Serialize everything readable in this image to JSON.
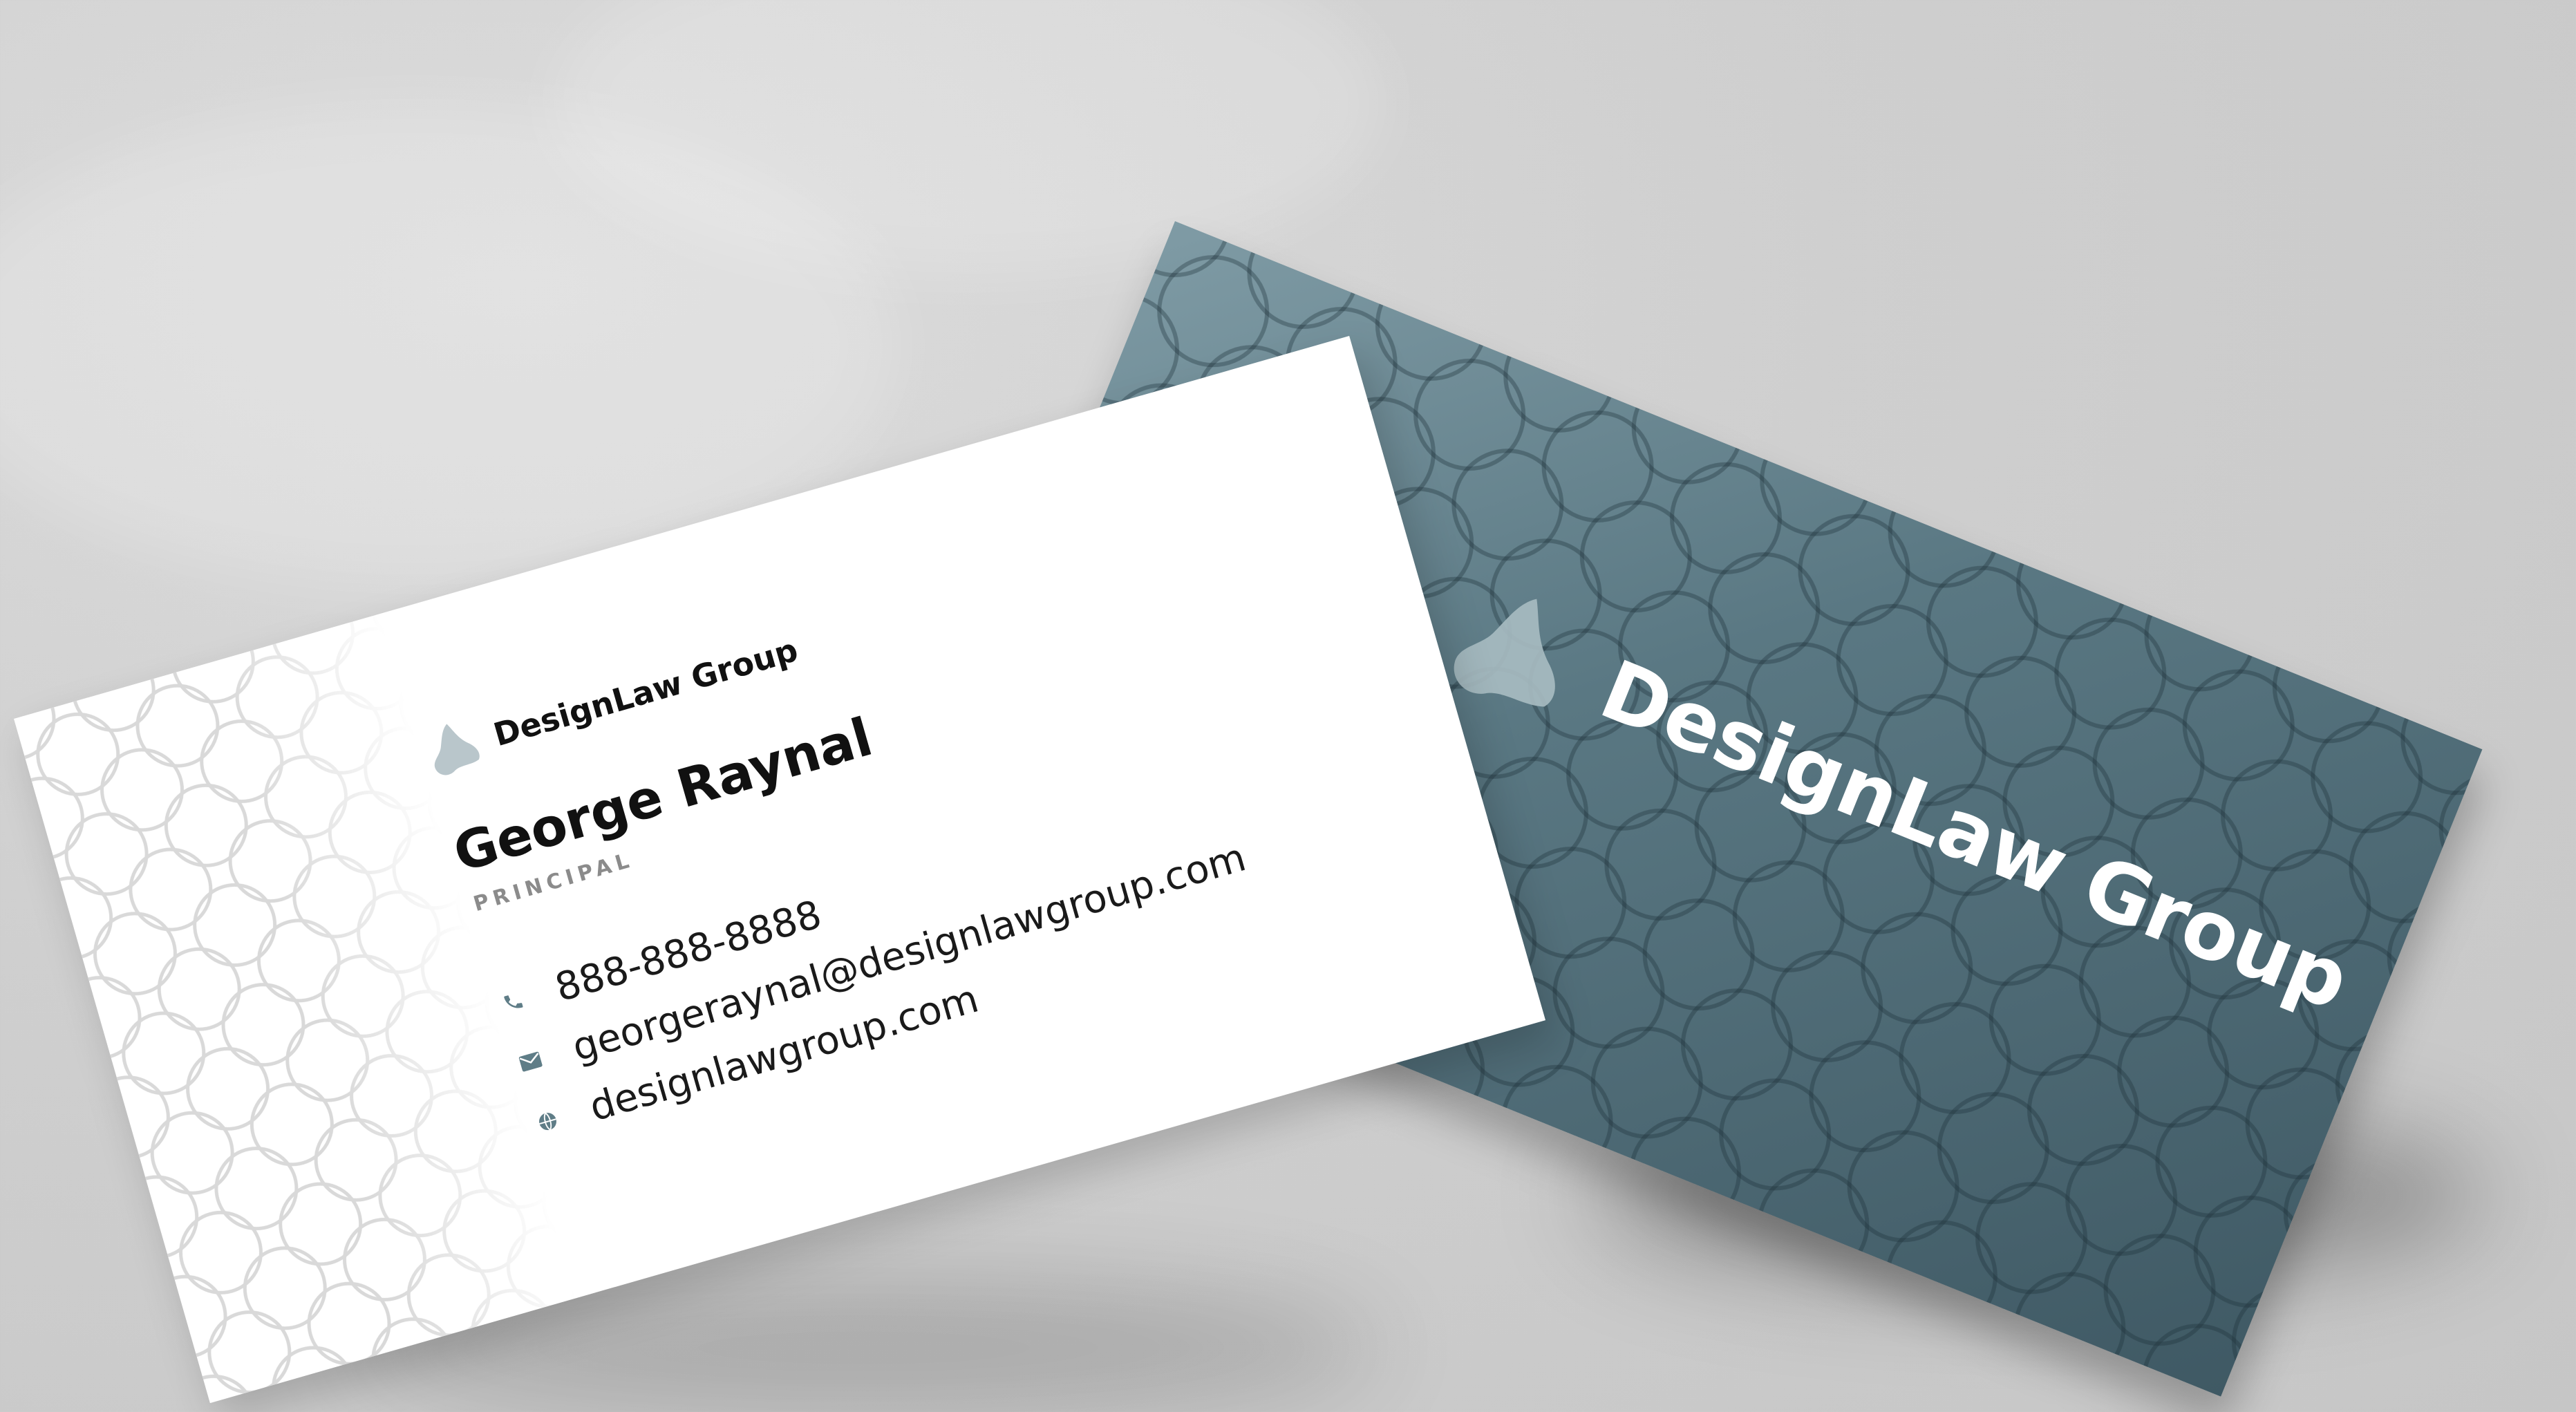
{
  "back_card": {
    "brand_name": "DesignLaw Group",
    "logo_icon": "triangle-blob-logo-icon",
    "background_color": "#4f6b76",
    "logo_color": "#a9bcc2"
  },
  "front_card": {
    "brand_name": "DesignLaw Group",
    "logo_icon": "triangle-blob-logo-icon",
    "person_name": "George Raynal",
    "person_title": "PRINCIPAL",
    "contacts": [
      {
        "icon": "phone-icon",
        "text": "888-888-8888"
      },
      {
        "icon": "envelope-icon",
        "text": "georgeraynal@designlawgroup.com"
      },
      {
        "icon": "globe-icon",
        "text": "designlawgroup.com"
      }
    ],
    "icon_color": "#5f7d87"
  }
}
